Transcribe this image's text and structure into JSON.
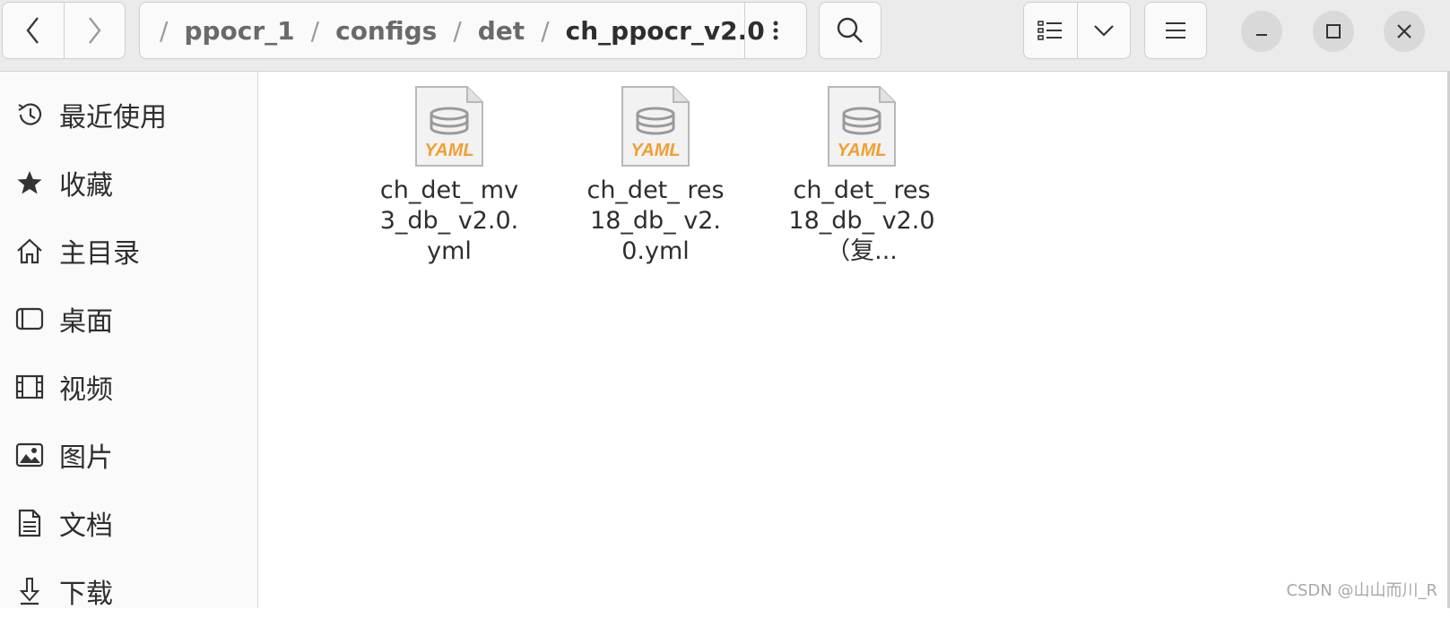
{
  "header": {
    "breadcrumb": [
      "ppocr_1",
      "configs",
      "det",
      "ch_ppocr_v2.0"
    ],
    "separator": "/"
  },
  "sidebar": {
    "items": [
      {
        "label": "最近使用",
        "icon": "recent-icon"
      },
      {
        "label": "收藏",
        "icon": "star-icon"
      },
      {
        "label": "主目录",
        "icon": "home-icon"
      },
      {
        "label": "桌面",
        "icon": "desktop-icon"
      },
      {
        "label": "视频",
        "icon": "video-icon"
      },
      {
        "label": "图片",
        "icon": "picture-icon"
      },
      {
        "label": "文档",
        "icon": "document-icon"
      },
      {
        "label": "下载",
        "icon": "download-icon"
      }
    ]
  },
  "files": [
    {
      "name": "ch_det_ mv3_db_ v2.0.yml",
      "icon_text": "YAML"
    },
    {
      "name": "ch_det_ res18_db_ v2.0.yml",
      "icon_text": "YAML"
    },
    {
      "name": "ch_det_ res18_db_ v2.0（复...",
      "icon_text": "YAML"
    }
  ],
  "watermark": "CSDN @山山而川_R",
  "colors": {
    "yaml_accent": "#f0a030",
    "headerbar": "#ebebeb",
    "sidebar": "#fafafa"
  }
}
